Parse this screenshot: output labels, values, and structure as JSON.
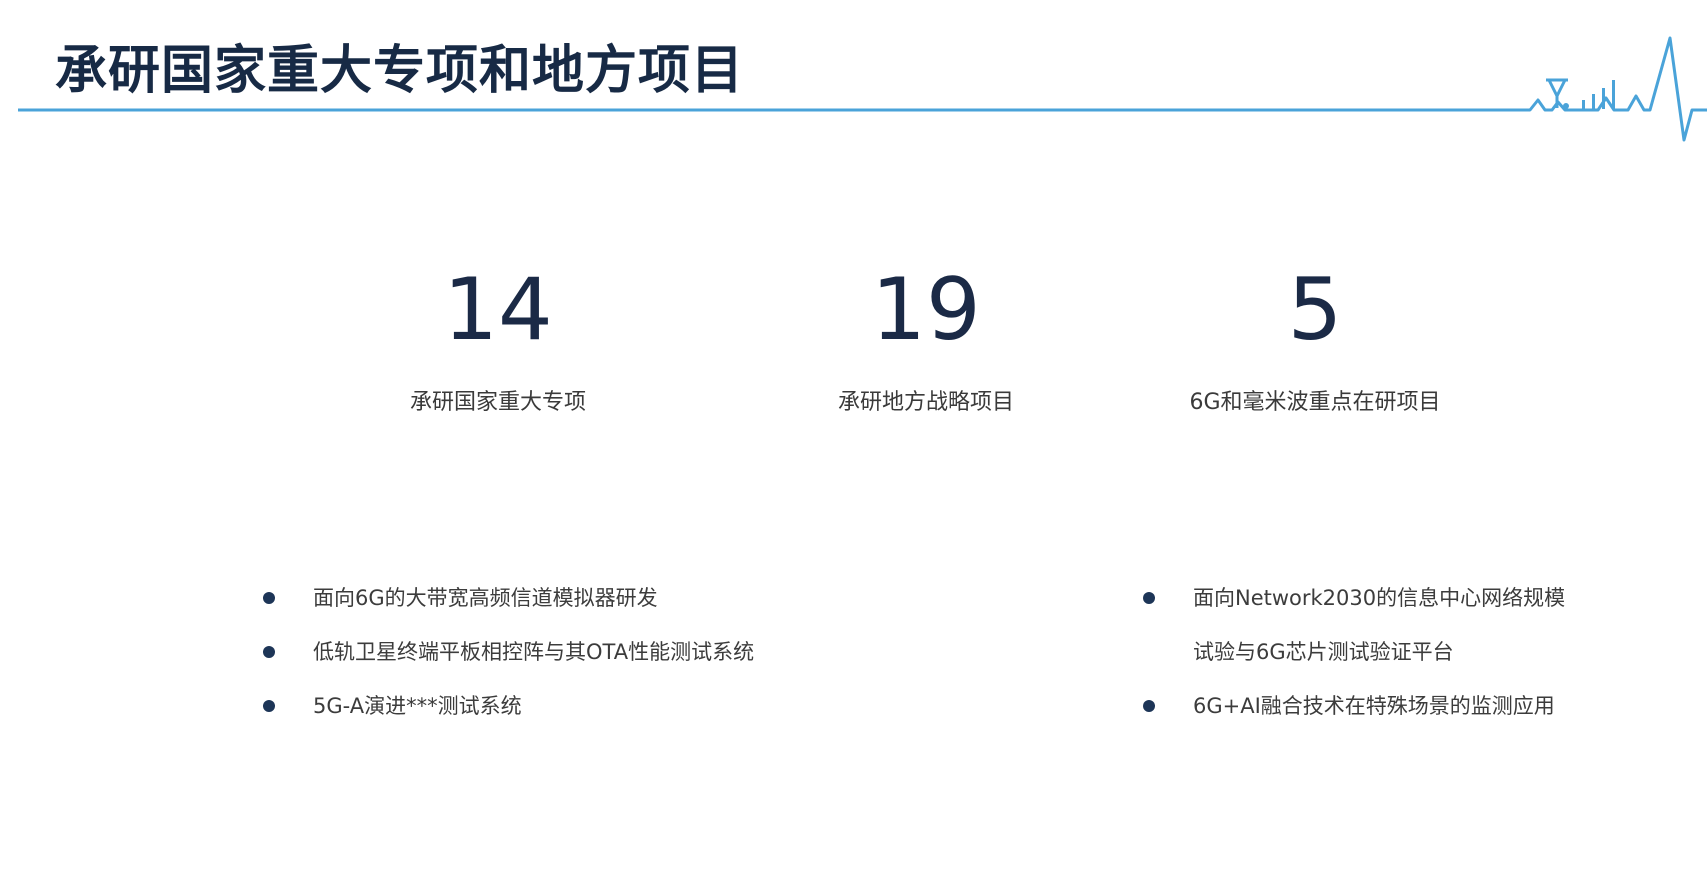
{
  "title": "承研国家重大专项和地方项目",
  "stats": [
    {
      "value": "14",
      "label": "承研国家重大专项"
    },
    {
      "value": "19",
      "label": "承研地方战略项目"
    },
    {
      "value": "5",
      "label": "6G和毫米波重点在研项目"
    }
  ],
  "left_list": [
    "面向6G的大带宽高频信道模拟器研发",
    "低轨卫星终端平板相控阵与其OTA性能测试系统",
    "5G-A演进***测试系统"
  ],
  "right_list": [
    {
      "line1": "面向Network2030的信息中心网络规模",
      "line2": "试验与6G芯片测试验证平台"
    },
    {
      "line1": "6G+AI融合技术在特殊场景的监测应用",
      "line2": ""
    }
  ],
  "colors": {
    "title": "#172a45",
    "accent_line": "#4aa3d9",
    "numbers": "#1b2a46",
    "bullet": "#1d3557"
  },
  "icons": [
    "signal-antenna-icon",
    "signal-bars-icon"
  ]
}
